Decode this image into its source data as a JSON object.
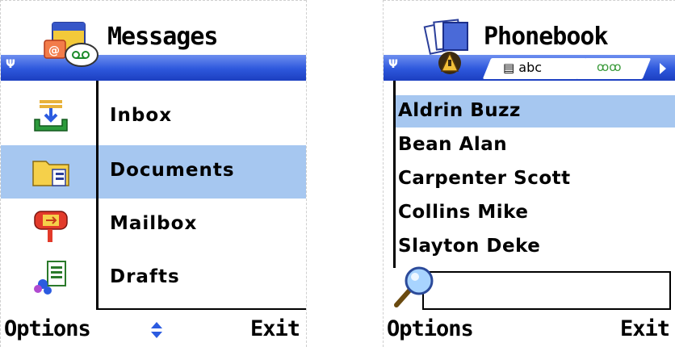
{
  "messages_screen": {
    "title": "Messages",
    "items": [
      {
        "label": "Inbox",
        "icon": "inbox-icon",
        "selected": false
      },
      {
        "label": "Documents",
        "icon": "documents-folder-icon",
        "selected": true
      },
      {
        "label": "Mailbox",
        "icon": "mailbox-icon",
        "selected": false
      },
      {
        "label": "Drafts",
        "icon": "drafts-icon",
        "selected": false
      }
    ],
    "softkeys": {
      "left": "Options",
      "right": "Exit"
    }
  },
  "phonebook_screen": {
    "title": "Phonebook",
    "tabs": [
      {
        "label": "abc",
        "icon": "contact-card-icon",
        "active": true
      },
      {
        "label": "",
        "icon": "groups-icon",
        "active": false
      }
    ],
    "contacts": [
      {
        "name": "Aldrin Buzz",
        "selected": true
      },
      {
        "name": "Bean Alan",
        "selected": false
      },
      {
        "name": "Carpenter Scott",
        "selected": false
      },
      {
        "name": "Collins Mike",
        "selected": false
      },
      {
        "name": "Slayton Deke",
        "selected": false
      }
    ],
    "search": {
      "value": ""
    },
    "softkeys": {
      "left": "Options",
      "right": "Exit"
    }
  },
  "colors": {
    "selection": "#a6c7f0",
    "navbar_top": "#6e8ff0",
    "navbar_bottom": "#1c3fc0"
  }
}
